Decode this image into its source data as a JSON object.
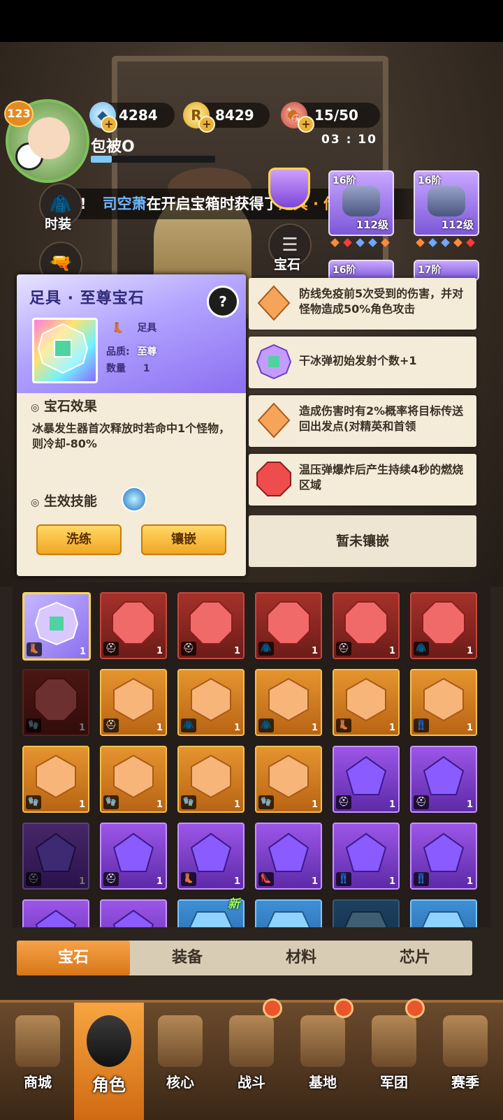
{
  "player": {
    "level": "123",
    "name": "包被O",
    "exp_fraction": 0.17
  },
  "currency": {
    "diamonds": "4284",
    "coins": "8429",
    "stamina": "15/50",
    "stamina_timer": "03 : 10"
  },
  "marquee": {
    "prefix": "!",
    "player": "司空萧",
    "middle": "在开启宝箱时获得了",
    "item": "足具 · 传说宝石",
    "suffix": "!"
  },
  "side_buttons": {
    "fashion": "时装",
    "gem": "宝石"
  },
  "gear": [
    {
      "tier": "16阶",
      "level": "112级"
    },
    {
      "tier": "16阶",
      "level": "112级"
    },
    {
      "tier": "16阶",
      "level": ""
    },
    {
      "tier": "17阶",
      "level": ""
    }
  ],
  "detail": {
    "title": "足具 · 至尊宝石",
    "help": "?",
    "slot_label": "足具",
    "quality_label": "品质:",
    "quality_value": "至尊",
    "count_label": "数量",
    "count_value": "1",
    "effect_title": "宝石效果",
    "effect_text": "冰暴发生器首次释放时若命中1个怪物，则冷却-80%",
    "skill_title": "生效技能",
    "btn_reroll": "洗练",
    "btn_inlay": "镶嵌"
  },
  "effects": [
    {
      "color": "orange",
      "text": "防线免疫前5次受到的伤害，并对怪物造成50%角色攻击"
    },
    {
      "color": "rainbow",
      "text": "干冰弹初始发射个数+1"
    },
    {
      "color": "orange",
      "text": "造成伤害时有2%概率将目标传送回出发点(对精英和首领"
    },
    {
      "color": "red",
      "text": "温压弹爆炸后产生持续4秒的燃烧区域"
    }
  ],
  "empty_slot": "暂未镶嵌",
  "inventory": [
    {
      "color": "legend",
      "type": "👢",
      "count": "1",
      "dim": false
    },
    {
      "color": "red",
      "type": "⛑",
      "count": "1",
      "dim": false
    },
    {
      "color": "red",
      "type": "⛑",
      "count": "1",
      "dim": false
    },
    {
      "color": "red",
      "type": "🧥",
      "count": "1",
      "dim": false
    },
    {
      "color": "red",
      "type": "⛑",
      "count": "1",
      "dim": false
    },
    {
      "color": "red",
      "type": "🧥",
      "count": "1",
      "dim": false
    },
    {
      "color": "red",
      "type": "🧤",
      "count": "1",
      "dim": true
    },
    {
      "color": "orange",
      "type": "⛑",
      "count": "1",
      "dim": false
    },
    {
      "color": "orange",
      "type": "🧥",
      "count": "1",
      "dim": false
    },
    {
      "color": "orange",
      "type": "🧥",
      "count": "1",
      "dim": false
    },
    {
      "color": "orange",
      "type": "👢",
      "count": "1",
      "dim": false
    },
    {
      "color": "orange",
      "type": "👖",
      "count": "1",
      "dim": false
    },
    {
      "color": "orange",
      "type": "🧤",
      "count": "1",
      "dim": false
    },
    {
      "color": "orange",
      "type": "🧤",
      "count": "1",
      "dim": false
    },
    {
      "color": "orange",
      "type": "🧤",
      "count": "1",
      "dim": false
    },
    {
      "color": "orange",
      "type": "🧤",
      "count": "1",
      "dim": false
    },
    {
      "color": "purple",
      "type": "⛑",
      "count": "1",
      "dim": false
    },
    {
      "color": "purple",
      "type": "⛑",
      "count": "1",
      "dim": false
    },
    {
      "color": "purple",
      "type": "⛑",
      "count": "1",
      "dim": true
    },
    {
      "color": "purple",
      "type": "⛑",
      "count": "1",
      "dim": false
    },
    {
      "color": "purple",
      "type": "👢",
      "count": "1",
      "dim": false
    },
    {
      "color": "purple",
      "type": "👠",
      "count": "1",
      "dim": false
    },
    {
      "color": "purple",
      "type": "👖",
      "count": "1",
      "dim": false
    },
    {
      "color": "purple",
      "type": "👖",
      "count": "1",
      "dim": false
    },
    {
      "color": "purple",
      "type": "",
      "count": "",
      "dim": false
    },
    {
      "color": "purple",
      "type": "",
      "count": "",
      "dim": false
    },
    {
      "color": "blue",
      "type": "",
      "count": "",
      "dim": false
    },
    {
      "color": "blue",
      "type": "",
      "count": "",
      "dim": false
    },
    {
      "color": "blue",
      "type": "",
      "count": "",
      "dim": true
    },
    {
      "color": "blue",
      "type": "",
      "count": "",
      "dim": false
    }
  ],
  "new_badge": "新",
  "tabs": [
    "宝石",
    "装备",
    "材料",
    "芯片"
  ],
  "active_tab": 0,
  "nav": [
    {
      "label": "商城",
      "dot": false
    },
    {
      "label": "角色",
      "dot": false
    },
    {
      "label": "核心",
      "dot": false
    },
    {
      "label": "战斗",
      "dot": true
    },
    {
      "label": "基地",
      "dot": true
    },
    {
      "label": "军团",
      "dot": true
    },
    {
      "label": "赛季",
      "dot": false
    }
  ],
  "active_nav": 1,
  "colors": {
    "accent_orange": "#f0a623",
    "legend_purple": "#8a6ff0",
    "panel_bg": "#f4ecd9"
  }
}
